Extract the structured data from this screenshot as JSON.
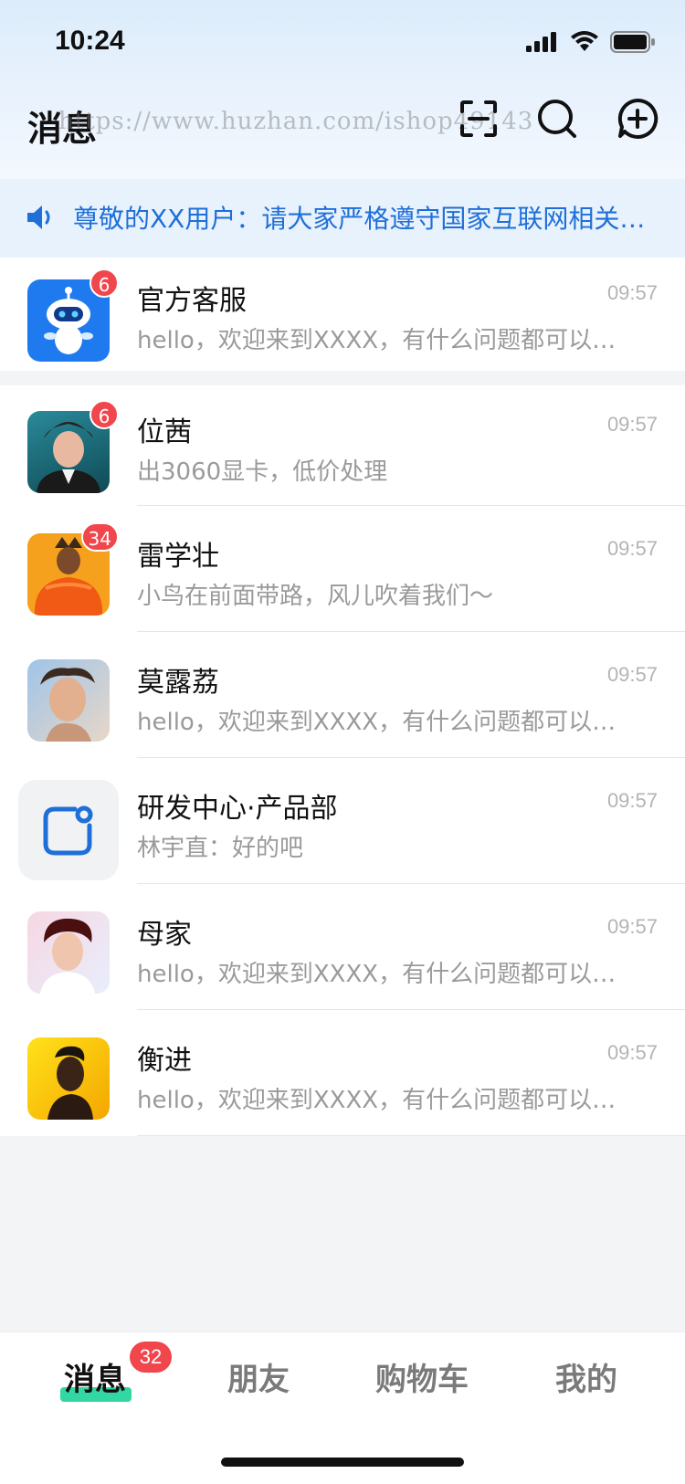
{
  "status_bar": {
    "time": "10:24"
  },
  "header": {
    "title": "消息",
    "watermark": "https://www.huzhan.com/ishop49143",
    "icons": [
      "scan-icon",
      "search-icon",
      "add-chat-icon"
    ]
  },
  "notice": {
    "icon": "speaker-icon",
    "text": "尊敬的XX用户：请大家严格遵守国家互联网相关…"
  },
  "chats": [
    {
      "name": "官方客服",
      "time": "09:57",
      "preview": "hello，欢迎来到XXXX，有什么问题都可以…",
      "badge": "6"
    },
    {
      "name": "位茜",
      "time": "09:57",
      "preview": "出3060显卡，低价处理",
      "badge": "6"
    },
    {
      "name": "雷学壮",
      "time": "09:57",
      "preview": "小鸟在前面带路，风儿吹着我们～",
      "badge": "34"
    },
    {
      "name": "莫露荔",
      "time": "09:57",
      "preview": "hello，欢迎来到XXXX，有什么问题都可以…",
      "badge": ""
    },
    {
      "name": "研发中心·产品部",
      "time": "09:57",
      "preview": "林宇直：好的吧",
      "badge": ""
    },
    {
      "name": "母家",
      "time": "09:57",
      "preview": "hello，欢迎来到XXXX，有什么问题都可以…",
      "badge": ""
    },
    {
      "name": "衡进",
      "time": "09:57",
      "preview": "hello，欢迎来到XXXX，有什么问题都可以…",
      "badge": ""
    }
  ],
  "tabs": {
    "messages": "消息",
    "messages_badge": "32",
    "friends": "朋友",
    "cart": "购物车",
    "mine": "我的"
  },
  "colors": {
    "accent": "#1f6fd8",
    "badge": "#f0464c",
    "tab_highlight": "#33d7a3"
  }
}
